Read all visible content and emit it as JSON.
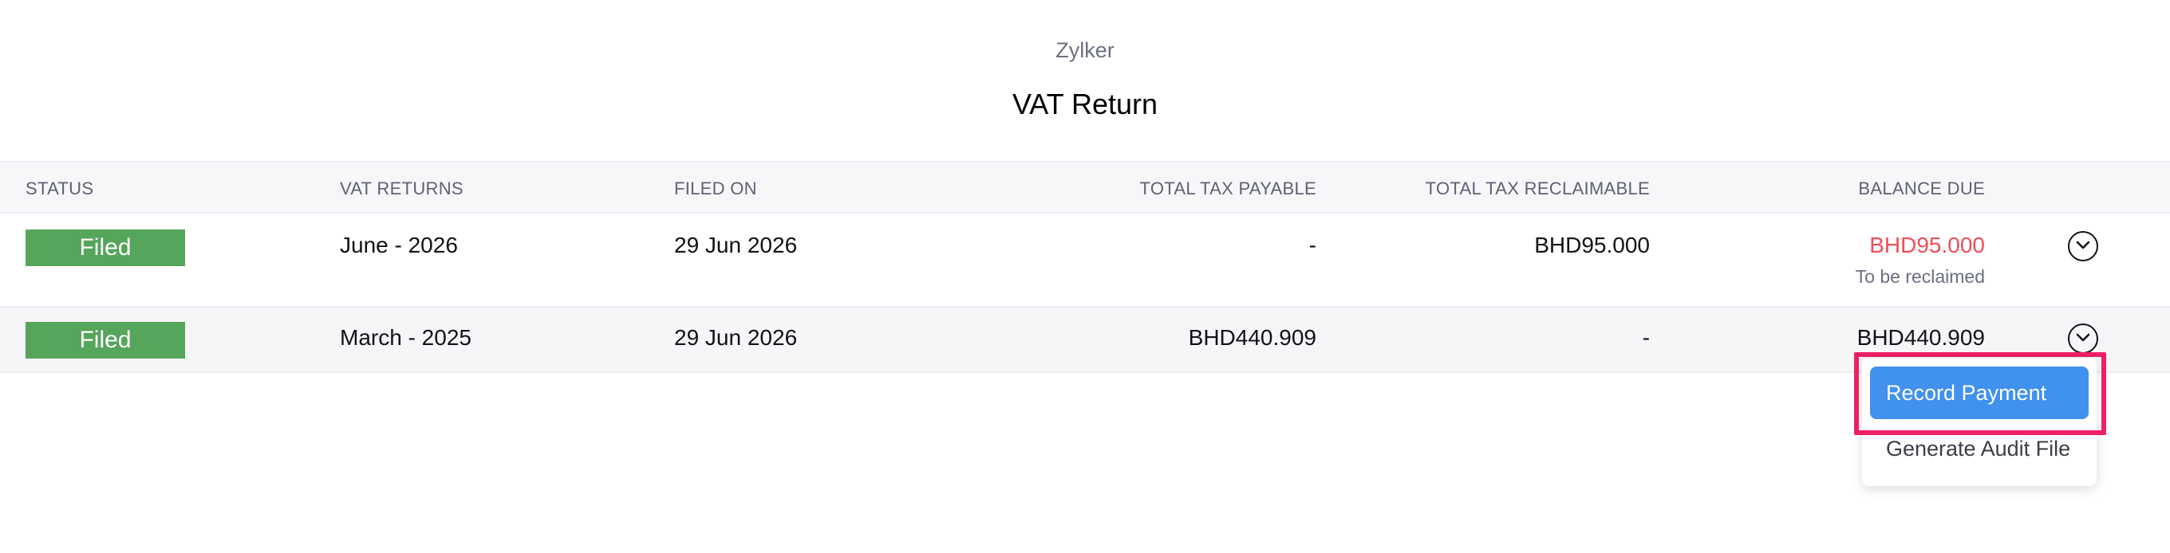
{
  "header": {
    "org_name": "Zylker",
    "title": "VAT Return"
  },
  "table": {
    "columns": {
      "status": "STATUS",
      "vat_returns": "VAT RETURNS",
      "filed_on": "FILED ON",
      "total_tax_payable": "TOTAL TAX PAYABLE",
      "total_tax_reclaimable": "TOTAL TAX RECLAIMABLE",
      "balance_due": "BALANCE DUE"
    },
    "rows": [
      {
        "status": "Filed",
        "period": "June - 2026",
        "filed_on": "29 Jun 2026",
        "tax_payable": "-",
        "tax_reclaimable": "BHD95.000",
        "balance_due": "BHD95.000",
        "balance_note": "To be reclaimed"
      },
      {
        "status": "Filed",
        "period": "March - 2025",
        "filed_on": "29 Jun 2026",
        "tax_payable": "BHD440.909",
        "tax_reclaimable": "-",
        "balance_due": "BHD440.909"
      }
    ]
  },
  "dropdown": {
    "record_payment": "Record Payment",
    "generate_audit_file": "Generate Audit File"
  },
  "colors": {
    "status_filed": "#55a55b",
    "negative_balance": "#ef4d5b",
    "primary_button": "#4191ef",
    "highlight_box": "#ef1f63"
  },
  "icons": {
    "row_action": "chevron-down-circle-icon"
  }
}
